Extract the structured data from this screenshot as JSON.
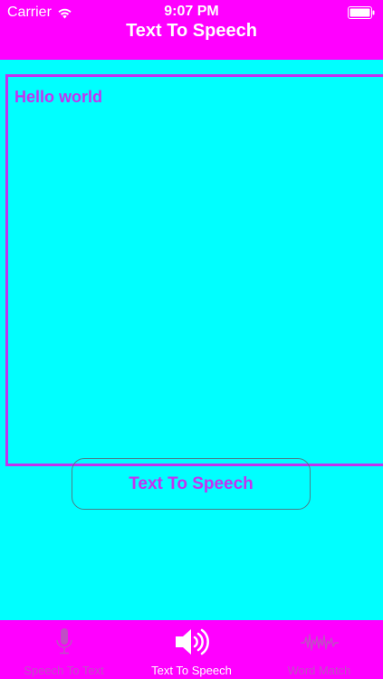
{
  "status_bar": {
    "carrier": "Carrier",
    "time": "9:07 PM",
    "wifi_icon": "wifi-icon",
    "battery_icon": "battery-icon"
  },
  "nav": {
    "title": "Text To Speech"
  },
  "editor": {
    "text": "Hello world"
  },
  "action": {
    "button_label": "Text To Speech"
  },
  "tab_bar": {
    "tabs": [
      {
        "label": "Speech To Text",
        "icon": "microphone-icon",
        "active": false
      },
      {
        "label": "Text To Speech",
        "icon": "speaker-icon",
        "active": true
      },
      {
        "label": "Word Match",
        "icon": "waveform-icon",
        "active": false
      }
    ]
  },
  "colors": {
    "background": "#00ffff",
    "bars": "#ff00ff",
    "accent": "#c233f0",
    "inactive_tab": "#bf4fc4",
    "active_tab": "#ffffff"
  }
}
